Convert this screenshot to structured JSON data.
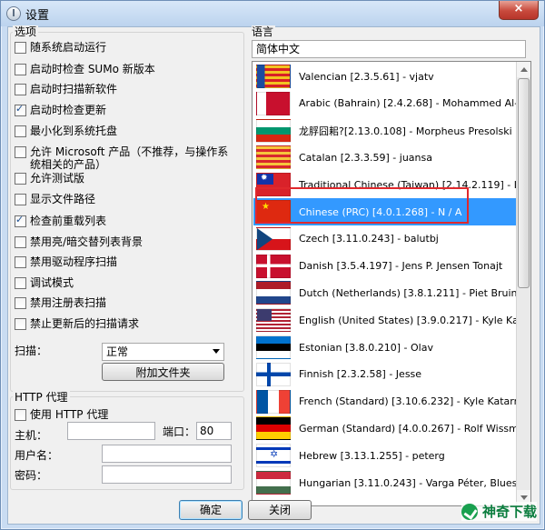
{
  "window": {
    "title": "设置",
    "close_label": "×"
  },
  "options": {
    "group_title": "选项",
    "items": [
      {
        "label": "随系统启动运行",
        "checked": false
      },
      {
        "label": "启动时检查 SUMo 新版本",
        "checked": false
      },
      {
        "label": "启动时扫描新软件",
        "checked": false
      },
      {
        "label": "启动时检查更新",
        "checked": true
      },
      {
        "label": "最小化到系统托盘",
        "checked": false
      },
      {
        "label": "允许 Microsoft 产品（不推荐，与操作系统相关的产品）",
        "checked": false
      },
      {
        "label": "允许测试版",
        "checked": false
      },
      {
        "label": "显示文件路径",
        "checked": false
      },
      {
        "label": "检查前重载列表",
        "checked": true
      },
      {
        "label": "禁用亮/暗交替列表背景",
        "checked": false
      },
      {
        "label": "禁用驱动程序扫描",
        "checked": false
      },
      {
        "label": "调试模式",
        "checked": false
      },
      {
        "label": "禁用注册表扫描",
        "checked": false
      },
      {
        "label": "禁止更新后的扫描请求",
        "checked": false
      }
    ],
    "scan_label": "扫描：",
    "scan_value": "正常",
    "attach_folder_button": "附加文件夹"
  },
  "proxy": {
    "group_title": "HTTP 代理",
    "use_proxy_label": "使用 HTTP 代理",
    "host_label": "主机：",
    "host_value": "",
    "port_label": "端口：",
    "port_value": "80",
    "username_label": "用户名：",
    "username_value": "",
    "password_label": "密码：",
    "password_value": ""
  },
  "language": {
    "group_title": "语言",
    "selected_label": "简体中文",
    "list": [
      {
        "label": "Valencian [2.3.5.61] - vjatv",
        "flag": "valencian"
      },
      {
        "label": "Arabic (Bahrain) [2.4.2.68] - Mohammed Al-Foulad",
        "flag": "bahrain"
      },
      {
        "label": "龙脬囧耜?[2.13.0.108] - Morpheus Presolski",
        "flag": "bulgarian-shield"
      },
      {
        "label": "Catalan [2.3.3.59] - juansa",
        "flag": "catalan"
      },
      {
        "label": "Traditional Chinese (Taiwan) [2.14.2.119] - IMOK",
        "flag": "taiwan"
      },
      {
        "label": "Chinese (PRC) [4.0.1.268] - N / A",
        "flag": "china",
        "selected": true
      },
      {
        "label": "Czech [3.11.0.243] - balutbj",
        "flag": "czech"
      },
      {
        "label": "Danish [3.5.4.197] - Jens P. Jensen Tonajt",
        "flag": "denmark"
      },
      {
        "label": "Dutch (Netherlands) [3.8.1.211] - Piet Bruinsma",
        "flag": "netherlands"
      },
      {
        "label": "English (United States) [3.9.0.217] - Kyle Katarn",
        "flag": "usa"
      },
      {
        "label": "Estonian [3.8.0.210] - Olav",
        "flag": "estonia"
      },
      {
        "label": "Finnish [2.3.2.58] - Jesse",
        "flag": "finland"
      },
      {
        "label": "French (Standard) [3.10.6.232] - Kyle Katarn",
        "flag": "france"
      },
      {
        "label": "German (Standard) [4.0.0.267] - Rolf Wissmann",
        "flag": "germany"
      },
      {
        "label": "Hebrew [3.13.1.255] - peterg",
        "flag": "israel"
      },
      {
        "label": "Hungarian [3.11.0.243] - Varga Péter, Bluestar",
        "flag": "hungary"
      }
    ],
    "scroll_fraction": 0.47
  },
  "buttons": {
    "ok": "确定",
    "close": "关闭"
  },
  "watermark": "神奇下载",
  "colors": {
    "selection": "#3399ff",
    "highlight_border": "#e0282c"
  }
}
